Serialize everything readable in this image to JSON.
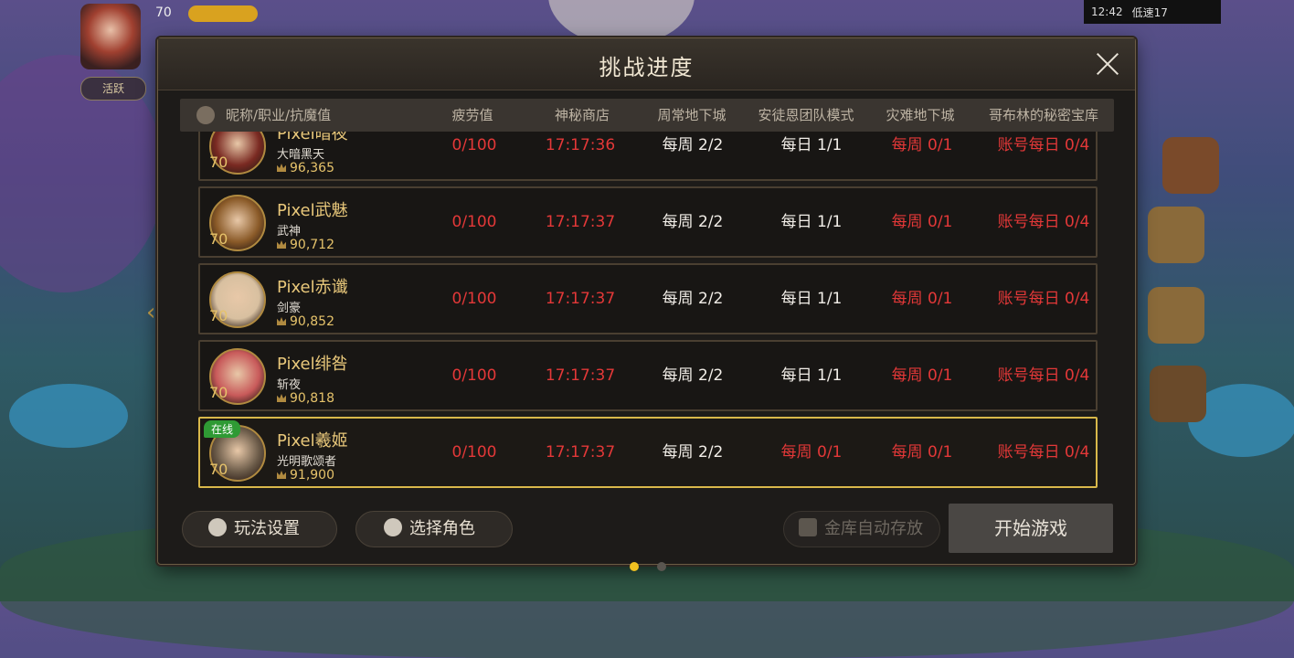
{
  "status_bar": {
    "time": "12:42",
    "net": "低速17"
  },
  "hud": {
    "player_level": "70",
    "tag": "活跃"
  },
  "dialog": {
    "title": "挑战进度"
  },
  "columns": [
    "昵称/职业/抗魔值",
    "疲劳值",
    "神秘商店",
    "周常地下城",
    "安徒恩团队模式",
    "灾难地下城",
    "哥布林的秘密宝库"
  ],
  "rows": [
    {
      "name": "Pixel暗夜",
      "job": "大暗黑天",
      "power": "96,365",
      "level": "70",
      "fatigue": "0/100",
      "shop": "17:17:36",
      "weekly": "每周 2/2",
      "anton": "每日 1/1",
      "disaster": "每周 0/1",
      "goblin": "账号每日 0/4",
      "online": "",
      "active": false
    },
    {
      "name": "Pixel武魅",
      "job": "武神",
      "power": "90,712",
      "level": "70",
      "fatigue": "0/100",
      "shop": "17:17:37",
      "weekly": "每周 2/2",
      "anton": "每日 1/1",
      "disaster": "每周 0/1",
      "goblin": "账号每日 0/4",
      "online": "",
      "active": false
    },
    {
      "name": "Pixel赤谶",
      "job": "剑豪",
      "power": "90,852",
      "level": "70",
      "fatigue": "0/100",
      "shop": "17:17:37",
      "weekly": "每周 2/2",
      "anton": "每日 1/1",
      "disaster": "每周 0/1",
      "goblin": "账号每日 0/4",
      "online": "",
      "active": false
    },
    {
      "name": "Pixel绯咎",
      "job": "斩夜",
      "power": "90,818",
      "level": "70",
      "fatigue": "0/100",
      "shop": "17:17:37",
      "weekly": "每周 2/2",
      "anton": "每日 1/1",
      "disaster": "每周 0/1",
      "goblin": "账号每日 0/4",
      "online": "",
      "active": false
    },
    {
      "name": "Pixel羲姬",
      "job": "光明歌颂者",
      "power": "91,900",
      "level": "70",
      "fatigue": "0/100",
      "shop": "17:17:37",
      "weekly": "每周 2/2",
      "anton": "每周 0/1",
      "disaster": "每周 0/1",
      "goblin": "账号每日 0/4",
      "online": "在线",
      "active": true
    }
  ],
  "buttons": {
    "settings": "玩法设置",
    "select_role": "选择角色",
    "auto_store": "金库自动存放",
    "start": "开始游戏"
  },
  "pagination": {
    "current": 1,
    "total": 2
  },
  "colors": {
    "accent": "#e8c77a",
    "alert": "#e33838",
    "active_border": "#d9b84a",
    "online": "#2f9a34"
  },
  "avatar_colors": [
    "#7a2a22",
    "#8a5a28",
    "#d8c0a0",
    "#c85a5a",
    "#6a5a48"
  ]
}
